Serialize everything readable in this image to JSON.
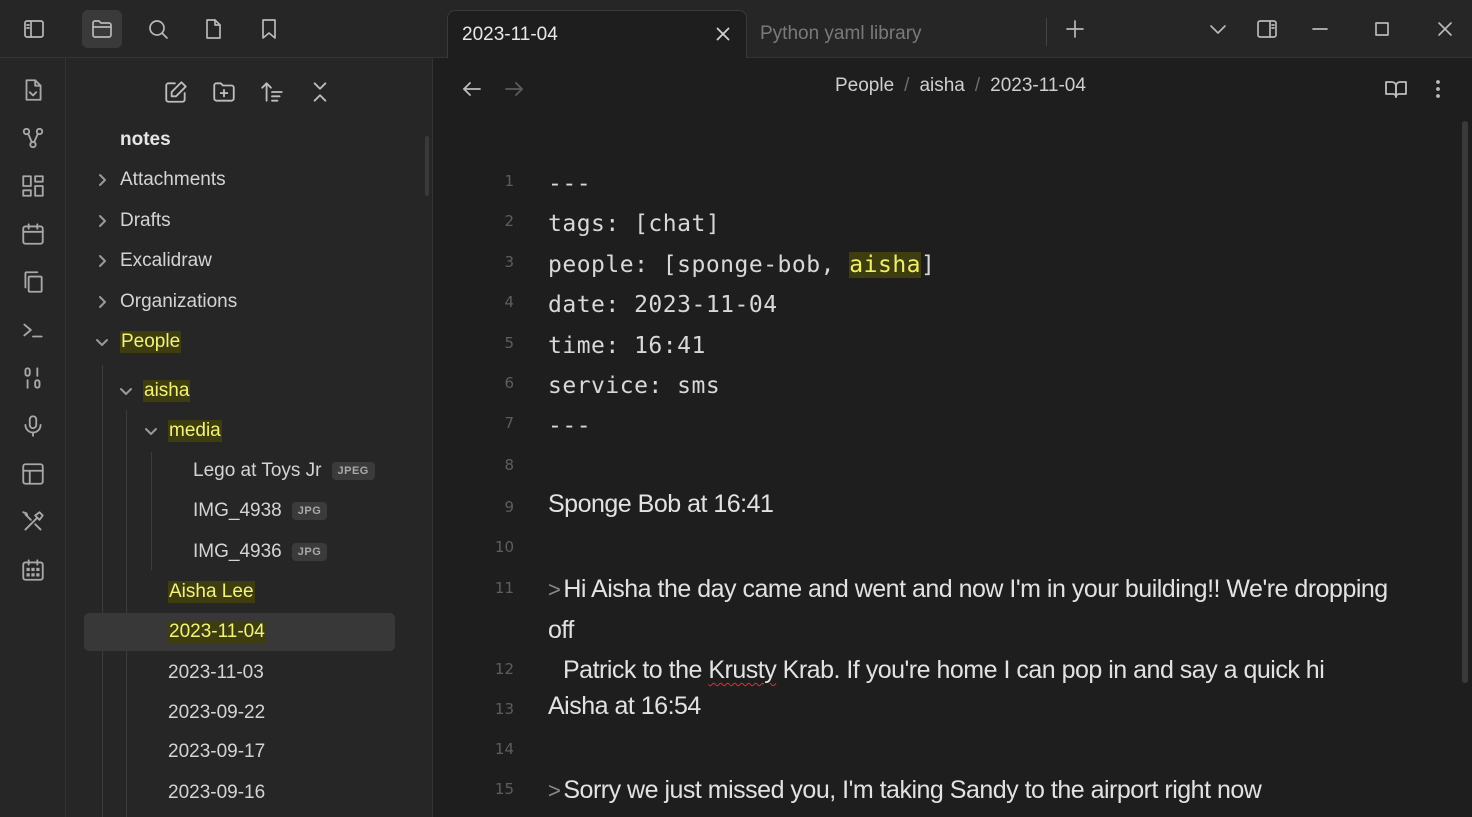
{
  "titlebar": {
    "tabs": [
      {
        "label": "2023-11-04",
        "active": true
      },
      {
        "label": "Python yaml library",
        "active": false
      }
    ]
  },
  "sidebar": {
    "vault_name": "notes",
    "items": [
      {
        "label": "Attachments",
        "type": "folder",
        "expanded": false
      },
      {
        "label": "Drafts",
        "type": "folder",
        "expanded": false
      },
      {
        "label": "Excalidraw",
        "type": "folder",
        "expanded": false
      },
      {
        "label": "Organizations",
        "type": "folder",
        "expanded": false
      },
      {
        "label": "People",
        "type": "folder",
        "expanded": true
      },
      {
        "label": "aisha",
        "type": "folder",
        "expanded": true
      },
      {
        "label": "media",
        "type": "folder",
        "expanded": true
      },
      {
        "label": "Lego at Toys Jr",
        "type": "file",
        "badge": "JPEG"
      },
      {
        "label": "IMG_4938",
        "type": "file",
        "badge": "JPG"
      },
      {
        "label": "IMG_4936",
        "type": "file",
        "badge": "JPG"
      },
      {
        "label": "Aisha Lee",
        "type": "file"
      },
      {
        "label": "2023-11-04",
        "type": "file",
        "selected": true
      },
      {
        "label": "2023-11-03",
        "type": "file"
      },
      {
        "label": "2023-09-22",
        "type": "file"
      },
      {
        "label": "2023-09-17",
        "type": "file"
      },
      {
        "label": "2023-09-16",
        "type": "file"
      }
    ]
  },
  "breadcrumb": {
    "parts": [
      "People",
      "aisha",
      "2023-11-04"
    ],
    "separator": "/"
  },
  "editor": {
    "line_numbers": [
      "1",
      "2",
      "3",
      "4",
      "5",
      "6",
      "7",
      "8",
      "9",
      "10",
      "11",
      "12",
      "13",
      "14",
      "15"
    ],
    "frontmatter": {
      "delim": "---",
      "tags_line": "tags: [chat]",
      "people_prefix": "people: [sponge-bob, ",
      "people_highlight": "aisha",
      "people_suffix": "]",
      "date_line": "date: 2023-11-04",
      "time_line": "time: 16:41",
      "service_line": "service: sms"
    },
    "heading1": "Sponge Bob at 16:41",
    "quote1_mark": ">",
    "quote1_line1": "Hi Aisha the day came and went and now I'm in your building!! We're dropping off",
    "quote1_line2_pre": "Patrick to the ",
    "quote1_line2_misspelled": "Krusty",
    "quote1_line2_post": " Krab. If you're home I can pop in and say a quick hi",
    "heading2": "Aisha at 16:54",
    "quote2_mark": ">",
    "quote2_line1": "Sorry we just missed you, I'm taking Sandy to the airport right now"
  },
  "colors": {
    "highlight_bg": "#3e3d10",
    "highlight_fg": "#f3f27a",
    "background": "#1e1e1e",
    "panel": "#262626"
  }
}
